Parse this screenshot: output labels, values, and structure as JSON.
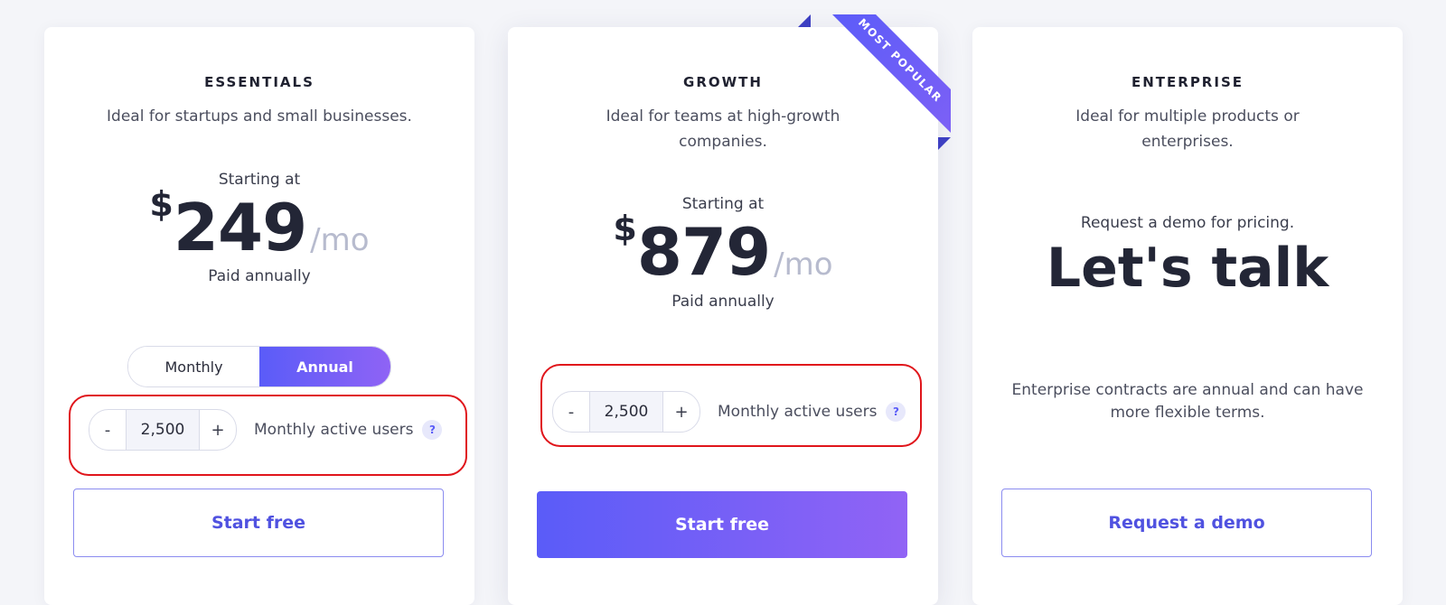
{
  "plans": [
    {
      "tier": "ESSENTIALS",
      "description": "Ideal for startups and small businesses.",
      "starting": "Starting at",
      "currency": "$",
      "amount": "249",
      "period": "/mo",
      "billing_note": "Paid annually",
      "toggle": {
        "monthly": "Monthly",
        "annual": "Annual",
        "selected": "Annual"
      },
      "users": {
        "minus": "-",
        "value": "2,500",
        "plus": "+",
        "label": "Monthly active users",
        "help": "?"
      },
      "cta": "Start free"
    },
    {
      "tier": "GROWTH",
      "description": "Ideal for teams at high-growth companies.",
      "ribbon": "MOST POPULAR",
      "starting": "Starting at",
      "currency": "$",
      "amount": "879",
      "period": "/mo",
      "billing_note": "Paid annually",
      "users": {
        "minus": "-",
        "value": "2,500",
        "plus": "+",
        "label": "Monthly active users",
        "help": "?"
      },
      "cta": "Start free"
    },
    {
      "tier": "ENTERPRISE",
      "description": "Ideal for multiple products or enterprises.",
      "request_text": "Request a demo for pricing.",
      "headline": "Let's talk",
      "note": "Enterprise contracts are annual and can have more flexible terms.",
      "cta": "Request a demo"
    }
  ],
  "colors": {
    "accent_start": "#5a5cf8",
    "accent_end": "#9163f5",
    "highlight": "#e0151b",
    "background": "#f4f5f9"
  }
}
